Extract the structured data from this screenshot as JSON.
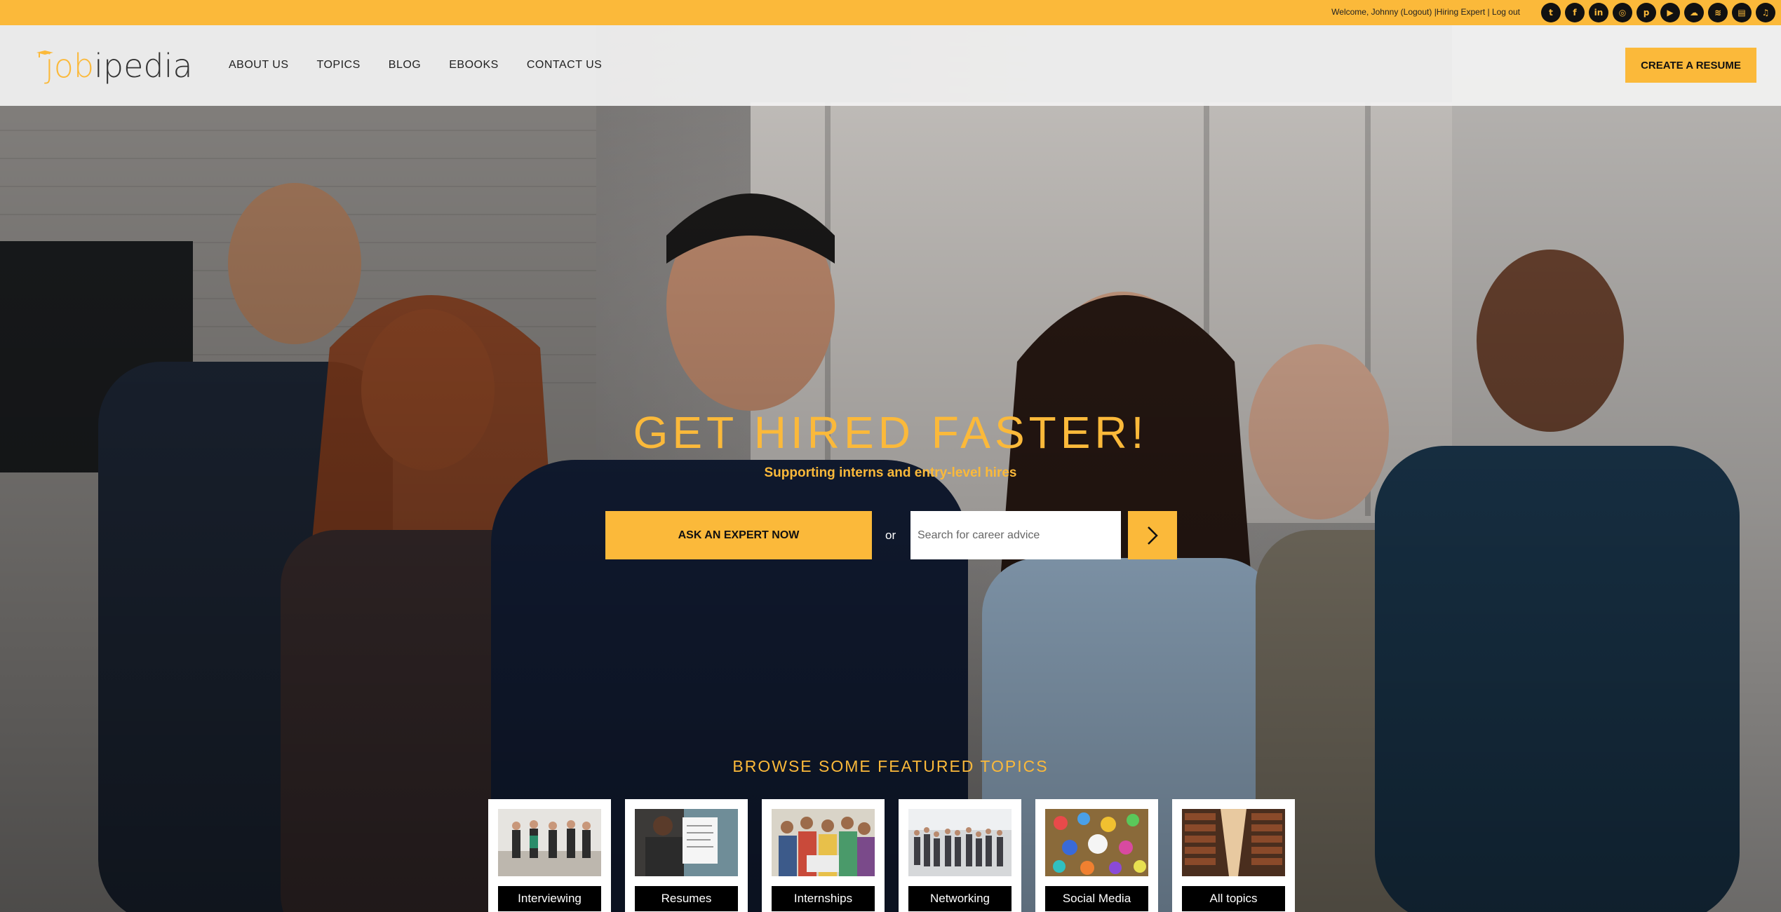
{
  "topbar": {
    "welcome_text": "Welcome, Johnny (Logout) |Hiring Expert | Log out",
    "socials": [
      {
        "icon": "twitter-icon",
        "glyph": "t"
      },
      {
        "icon": "facebook-icon",
        "glyph": "f"
      },
      {
        "icon": "linkedin-icon",
        "glyph": "in"
      },
      {
        "icon": "instagram-icon",
        "glyph": "◎"
      },
      {
        "icon": "pinterest-icon",
        "glyph": "p"
      },
      {
        "icon": "youtube-icon",
        "glyph": "▶"
      },
      {
        "icon": "soundcloud-icon",
        "glyph": "☁"
      },
      {
        "icon": "spotify-icon",
        "glyph": "≋"
      },
      {
        "icon": "stitcher-icon",
        "glyph": "▤"
      },
      {
        "icon": "itunes-icon",
        "glyph": "♫"
      }
    ]
  },
  "header": {
    "logo_job": "job",
    "logo_pedia": "ipedia",
    "nav": [
      "ABOUT US",
      "TOPICS",
      "BLOG",
      "EBOOKS",
      "CONTACT US"
    ],
    "cta": "CREATE A RESUME"
  },
  "hero": {
    "headline": "GET HIRED FASTER!",
    "subline": "Supporting interns and entry-level hires",
    "ask_button": "ASK AN EXPERT NOW",
    "or": "or",
    "search_placeholder": "Search for career advice"
  },
  "featured": {
    "title": "BROWSE SOME FEATURED TOPICS",
    "topics": [
      "Interviewing",
      "Resumes",
      "Internships",
      "Networking",
      "Social Media",
      "All topics"
    ]
  },
  "colors": {
    "accent": "#fbb93a",
    "dark": "#111111",
    "header_bg": "#f2f2f2"
  }
}
